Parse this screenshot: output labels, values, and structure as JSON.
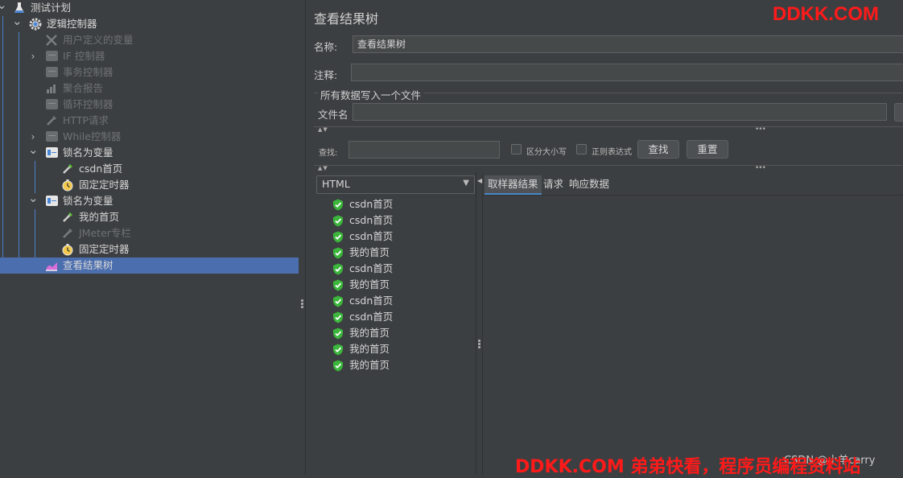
{
  "tree": {
    "nodes": [
      {
        "label": "测试计划",
        "icon": "flask-icon",
        "arrow": "⌄",
        "level": 0,
        "state": "enabled"
      },
      {
        "label": "逻辑控制器",
        "icon": "gear-icon",
        "arrow": "⌄",
        "level": 1,
        "state": "enabled"
      },
      {
        "label": "用户定义的变量",
        "icon": "wrench-cross-icon",
        "arrow": "",
        "level": 2,
        "state": "disabled"
      },
      {
        "label": "IF 控制器",
        "icon": "controller-box-icon",
        "arrow": "›",
        "level": 2,
        "state": "disabled"
      },
      {
        "label": "事务控制器",
        "icon": "controller-box-icon",
        "arrow": "",
        "level": 2,
        "state": "disabled"
      },
      {
        "label": "聚合报告",
        "icon": "bar-chart-icon",
        "arrow": "",
        "level": 2,
        "state": "disabled"
      },
      {
        "label": "循环控制器",
        "icon": "controller-box-icon",
        "arrow": "",
        "level": 2,
        "state": "disabled"
      },
      {
        "label": "HTTP请求",
        "icon": "pipette-icon",
        "arrow": "",
        "level": 2,
        "state": "disabled"
      },
      {
        "label": "While控制器",
        "icon": "controller-box-icon",
        "arrow": "›",
        "level": 2,
        "state": "disabled"
      },
      {
        "label": "锁名为变量",
        "icon": "critical-section-icon",
        "arrow": "⌄",
        "level": 2,
        "state": "enabled"
      },
      {
        "label": "csdn首页",
        "icon": "pipette-icon",
        "arrow": "",
        "level": 3,
        "state": "enabled"
      },
      {
        "label": "固定定时器",
        "icon": "stopwatch-icon",
        "arrow": "",
        "level": 3,
        "state": "enabled"
      },
      {
        "label": "锁名为变量",
        "icon": "critical-section-icon",
        "arrow": "⌄",
        "level": 2,
        "state": "enabled"
      },
      {
        "label": "我的首页",
        "icon": "pipette-icon",
        "arrow": "",
        "level": 3,
        "state": "enabled"
      },
      {
        "label": "JMeter专栏",
        "icon": "pipette-icon",
        "arrow": "",
        "level": 3,
        "state": "disabled"
      },
      {
        "label": "固定定时器",
        "icon": "stopwatch-icon",
        "arrow": "",
        "level": 3,
        "state": "enabled"
      },
      {
        "label": "查看结果树",
        "icon": "result-tree-icon",
        "arrow": "",
        "level": 2,
        "state": "selected"
      }
    ]
  },
  "main": {
    "title": "查看结果树",
    "name_label": "名称:",
    "name_value": "查看结果树",
    "comment_label": "注释:",
    "comment_value": "",
    "file_group_title": "所有数据写入一个文件",
    "file_label": "文件名",
    "file_value": "",
    "search_label": "查找:",
    "search_value": "",
    "case_sensitive_label": "区分大小写",
    "regex_label": "正则表达式",
    "find_button": "查找",
    "reset_button": "重置",
    "render_combo_value": "HTML",
    "results": [
      {
        "label": "csdn首页",
        "status": "success"
      },
      {
        "label": "csdn首页",
        "status": "success"
      },
      {
        "label": "csdn首页",
        "status": "success"
      },
      {
        "label": "我的首页",
        "status": "success"
      },
      {
        "label": "csdn首页",
        "status": "success"
      },
      {
        "label": "我的首页",
        "status": "success"
      },
      {
        "label": "csdn首页",
        "status": "success"
      },
      {
        "label": "csdn首页",
        "status": "success"
      },
      {
        "label": "我的首页",
        "status": "success"
      },
      {
        "label": "我的首页",
        "status": "success"
      },
      {
        "label": "我的首页",
        "status": "success"
      }
    ],
    "tabs": [
      "取样器结果",
      "请求",
      "响应数据"
    ],
    "active_tab": "取样器结果"
  },
  "watermarks": {
    "top": "DDKK.COM",
    "bottom": "DDKK.COM 弟弟快看，程序员编程资料站",
    "csdn": "CSDN @小羊carry"
  },
  "colors": {
    "background": "#3c3f41",
    "selection": "#4b6eaf",
    "success": "#3bb53b",
    "watermark": "#ff1a1a",
    "tree_guide": "#4a7fc8"
  }
}
